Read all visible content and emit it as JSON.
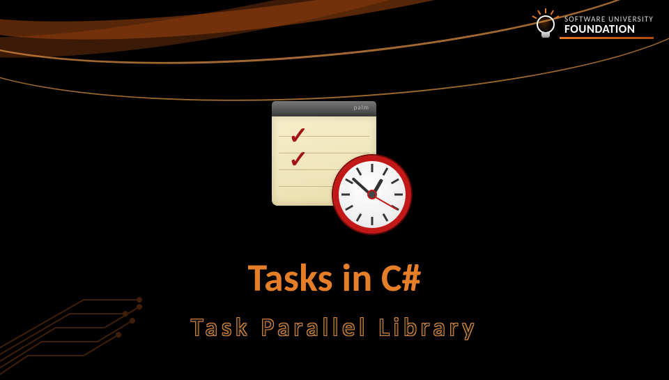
{
  "logo": {
    "line1": "SOFTWARE UNIVERSITY",
    "line2": "FOUNDATION",
    "icon": "lightbulb-idea-icon"
  },
  "slide": {
    "title": "Tasks in C#",
    "subtitle": "Task Parallel Library",
    "illustration": "notepad-checklist-with-clock-icon"
  }
}
